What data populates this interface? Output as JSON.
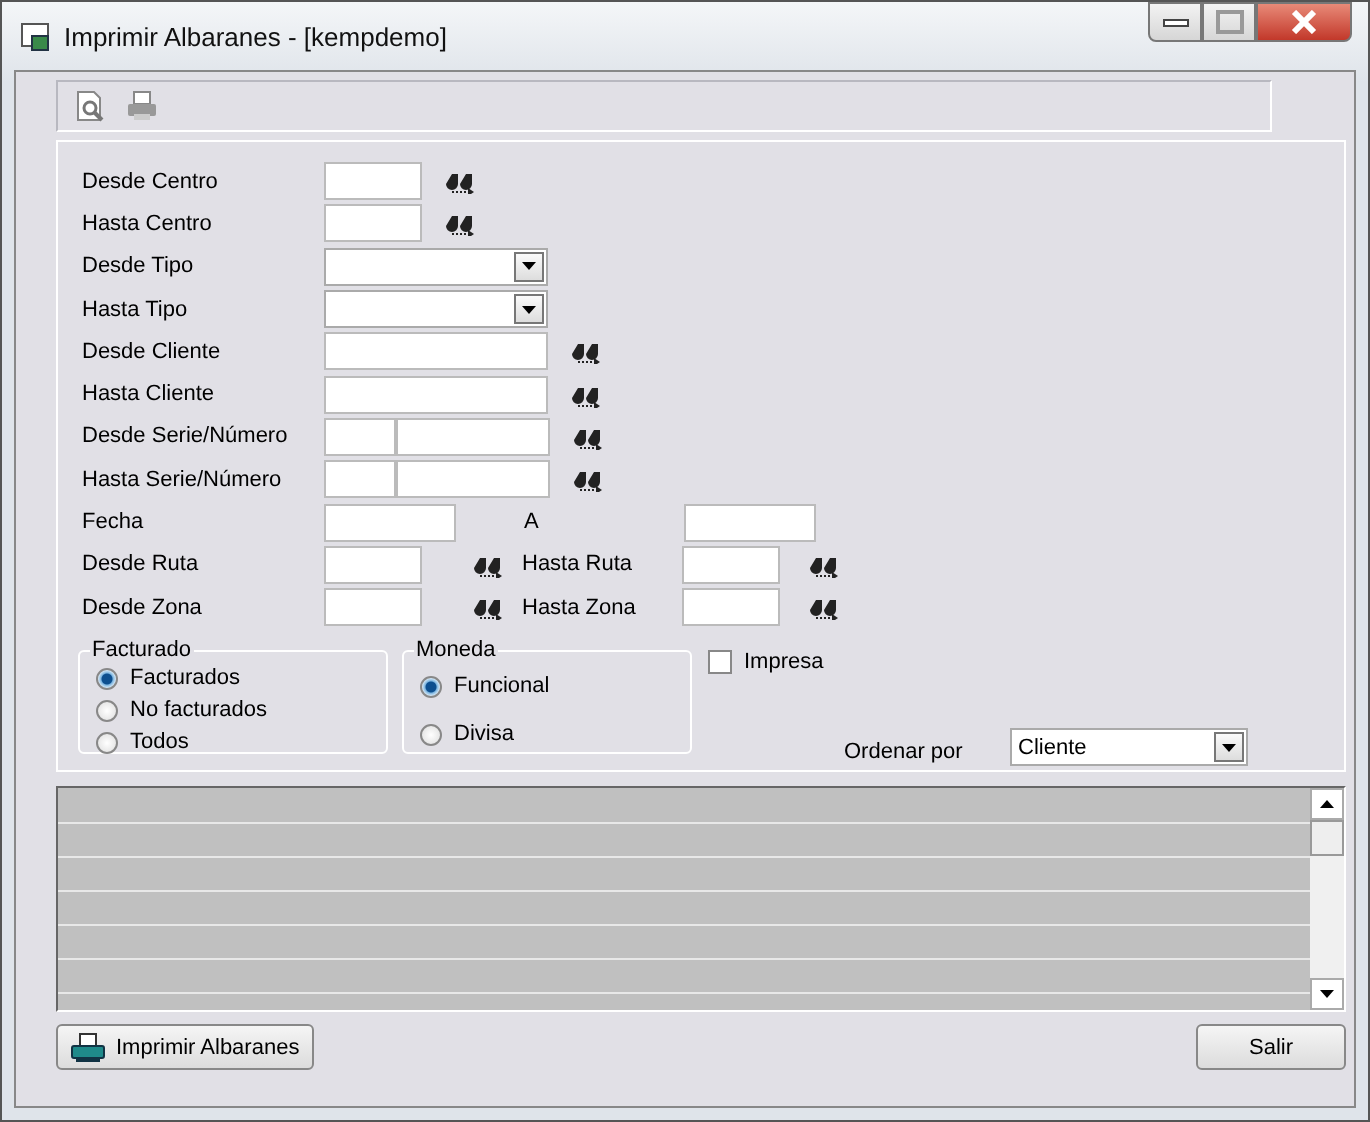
{
  "window": {
    "title": "Imprimir Albaranes - [kempdemo]"
  },
  "filters": [
    {
      "kind": "lookup",
      "label": "Desde Centro"
    },
    {
      "kind": "lookup",
      "label": "Hasta Centro"
    },
    {
      "kind": "combo",
      "label": "Desde Tipo"
    },
    {
      "kind": "combo",
      "label": "Hasta Tipo"
    },
    {
      "kind": "widelookup",
      "label": "Desde Cliente"
    },
    {
      "kind": "widelookup",
      "label": "Hasta Cliente"
    },
    {
      "kind": "serie",
      "label": "Desde Serie/Número"
    },
    {
      "kind": "serie",
      "label": "Hasta Serie/Número"
    },
    {
      "kind": "range",
      "label": "Fecha",
      "to_label": "A"
    },
    {
      "kind": "pair",
      "label": "Desde Ruta",
      "to_label": "Hasta Ruta"
    },
    {
      "kind": "pair",
      "label": "Desde Zona",
      "to_label": "Hasta Zona"
    }
  ],
  "groups": [
    {
      "title": "Facturado",
      "options": [
        {
          "label": "Facturados",
          "selected": true
        },
        {
          "label": "No facturados",
          "selected": false
        },
        {
          "label": "Todos",
          "selected": false
        }
      ]
    },
    {
      "title": "Moneda",
      "options": [
        {
          "label": "Funcional",
          "selected": true
        },
        {
          "label": "Divisa",
          "selected": false
        }
      ]
    }
  ],
  "impresa": {
    "label": "Impresa",
    "checked": false
  },
  "order": {
    "label": "Ordenar por",
    "value": "Cliente"
  },
  "buttons": [
    {
      "kind": "print",
      "label": "Imprimir Albaranes"
    },
    {
      "kind": "exit",
      "label": "Salir"
    }
  ]
}
